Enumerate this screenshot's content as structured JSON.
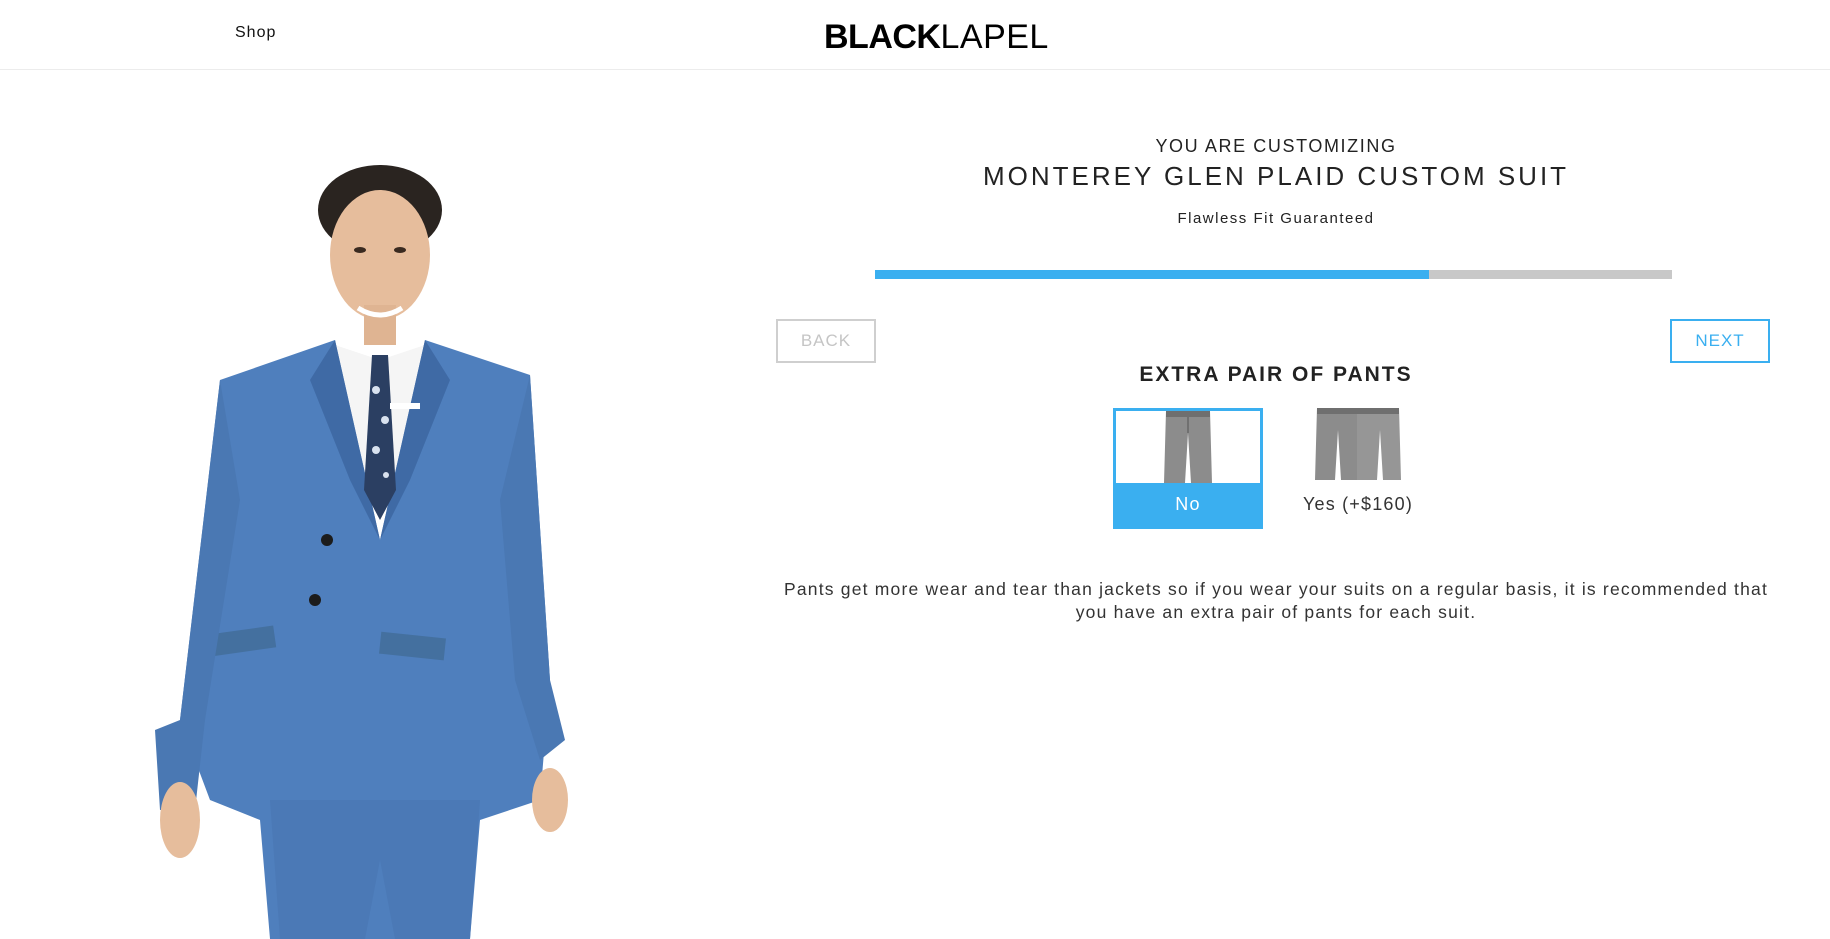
{
  "header": {
    "shop_label": "Shop",
    "logo_bold": "BLACK",
    "logo_light": "LAPEL"
  },
  "model_image": {
    "description_icon": "model-photo"
  },
  "configurator": {
    "customizing_label": "YOU ARE CUSTOMIZING",
    "product_title": "MONTEREY GLEN PLAID CUSTOM SUIT",
    "guarantee": "Flawless Fit Guaranteed",
    "progress_fraction": 0.695,
    "back_label": "BACK",
    "next_label": "NEXT",
    "section_title": "EXTRA PAIR OF PANTS",
    "options": [
      {
        "label": "No",
        "selected": true,
        "icon": "single-pants-icon"
      },
      {
        "label": "Yes (+$160)",
        "selected": false,
        "icon": "double-pants-icon"
      }
    ],
    "description": "Pants get more wear and tear than jackets so if you wear your suits on a regular basis, it is recommended that you have an extra pair of pants for each suit."
  },
  "colors": {
    "accent": "#3aaff0",
    "progress_track": "#c8c8c8",
    "disabled": "#c5c5c5",
    "suit_blue": "#4f7fbd"
  }
}
